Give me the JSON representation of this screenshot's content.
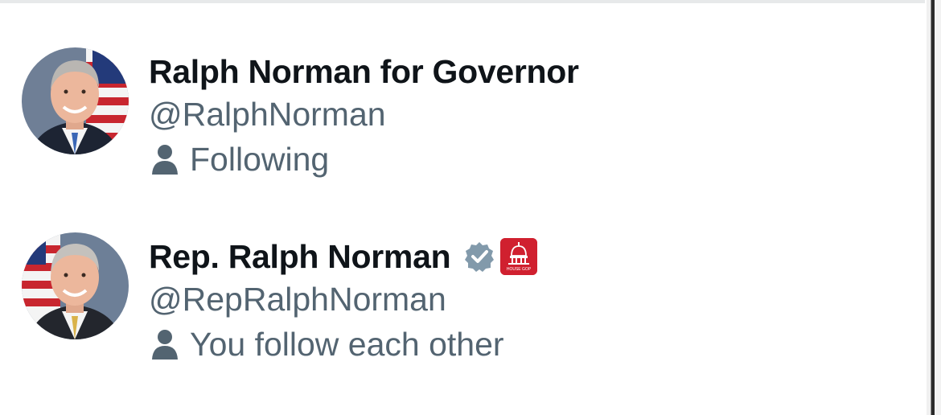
{
  "users": [
    {
      "display_name": "Ralph Norman for Governor",
      "handle": "@RalphNorman",
      "relationship": "Following",
      "avatar_icon": "profile-photo-flag-background",
      "verified": false,
      "affiliate_badge": false
    },
    {
      "display_name": "Rep. Ralph Norman",
      "handle": "@RepRalphNorman",
      "relationship": "You follow each other",
      "avatar_icon": "profile-photo-flag-background",
      "verified": true,
      "verified_icon": "gray-verified-badge-icon",
      "affiliate_badge": true,
      "affiliate_icon": "house-gop-capitol-icon",
      "affiliate_badge_text": "HOUSE GOP"
    }
  ],
  "colors": {
    "name_text": "#0f1419",
    "secondary_text": "#536471",
    "verified_gray": "#829aab",
    "affiliate_red": "#d0202f"
  }
}
